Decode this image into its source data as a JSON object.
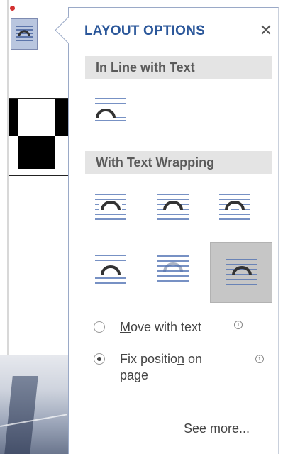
{
  "panel": {
    "title": "LAYOUT OPTIONS",
    "close_glyph": "✕",
    "close_icon": "close-icon"
  },
  "sections": {
    "inline": {
      "header": "In Line with Text",
      "options": [
        {
          "id": "in-line-with-text",
          "icon": "inline-wrap-icon",
          "selected": false
        }
      ]
    },
    "wrapping": {
      "header": "With Text Wrapping",
      "options": [
        {
          "id": "square",
          "icon": "square-wrap-icon",
          "selected": false
        },
        {
          "id": "tight",
          "icon": "tight-wrap-icon",
          "selected": false
        },
        {
          "id": "through",
          "icon": "through-wrap-icon",
          "selected": false
        },
        {
          "id": "top-and-bottom",
          "icon": "top-bottom-wrap-icon",
          "selected": false
        },
        {
          "id": "behind-text",
          "icon": "behind-text-wrap-icon",
          "selected": false
        },
        {
          "id": "in-front-of-text",
          "icon": "in-front-of-text-wrap-icon",
          "selected": true
        }
      ]
    }
  },
  "position_options": [
    {
      "label_before": "",
      "label_underlined": "M",
      "label_after": "ove with text",
      "line2": "",
      "checked": false
    },
    {
      "label_before": "Fix positio",
      "label_underlined": "n",
      "label_after": " on",
      "line2": "page",
      "checked": true
    }
  ],
  "info_glyph": "i",
  "see_more": "See more...",
  "colors": {
    "accent": "#2b579a",
    "icon_lines": "#4a6db0",
    "icon_shape": "#333333",
    "selected_bg": "#c6c6c6",
    "section_bg": "#e4e4e4"
  }
}
